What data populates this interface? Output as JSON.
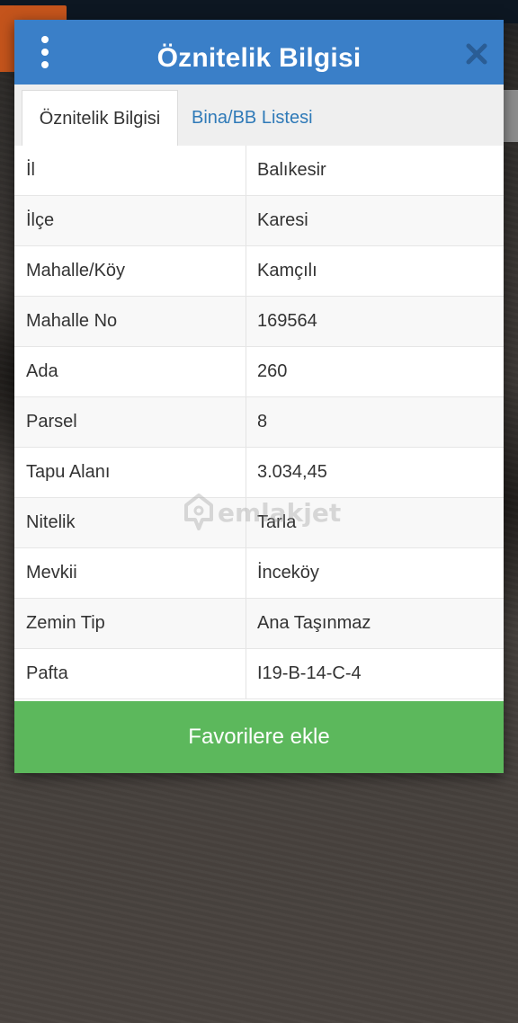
{
  "dialog": {
    "title": "Öznitelik Bilgisi",
    "menu_icon": "kebab-menu-icon",
    "close_icon": "close-icon"
  },
  "tabs": [
    {
      "label": "Öznitelik Bilgisi",
      "active": true
    },
    {
      "label": "Bina/BB Listesi",
      "active": false
    }
  ],
  "attributes": [
    {
      "key": "İl",
      "value": "Balıkesir"
    },
    {
      "key": "İlçe",
      "value": "Karesi"
    },
    {
      "key": "Mahalle/Köy",
      "value": "Kamçılı"
    },
    {
      "key": "Mahalle No",
      "value": "169564"
    },
    {
      "key": "Ada",
      "value": "260"
    },
    {
      "key": "Parsel",
      "value": "8"
    },
    {
      "key": "Tapu Alanı",
      "value": "3.034,45"
    },
    {
      "key": "Nitelik",
      "value": "Tarla"
    },
    {
      "key": "Mevkii",
      "value": "İnceköy"
    },
    {
      "key": "Zemin Tip",
      "value": "Ana Taşınmaz"
    },
    {
      "key": "Pafta",
      "value": "I19-B-14-C-4"
    }
  ],
  "favorite_button": {
    "label": "Favorilere ekle"
  },
  "watermark": {
    "text": "emlakjet",
    "icon": "location-pin-icon"
  },
  "colors": {
    "header": "#3a7fc8",
    "button": "#5cb85c",
    "tab_link": "#2f7ab8"
  }
}
